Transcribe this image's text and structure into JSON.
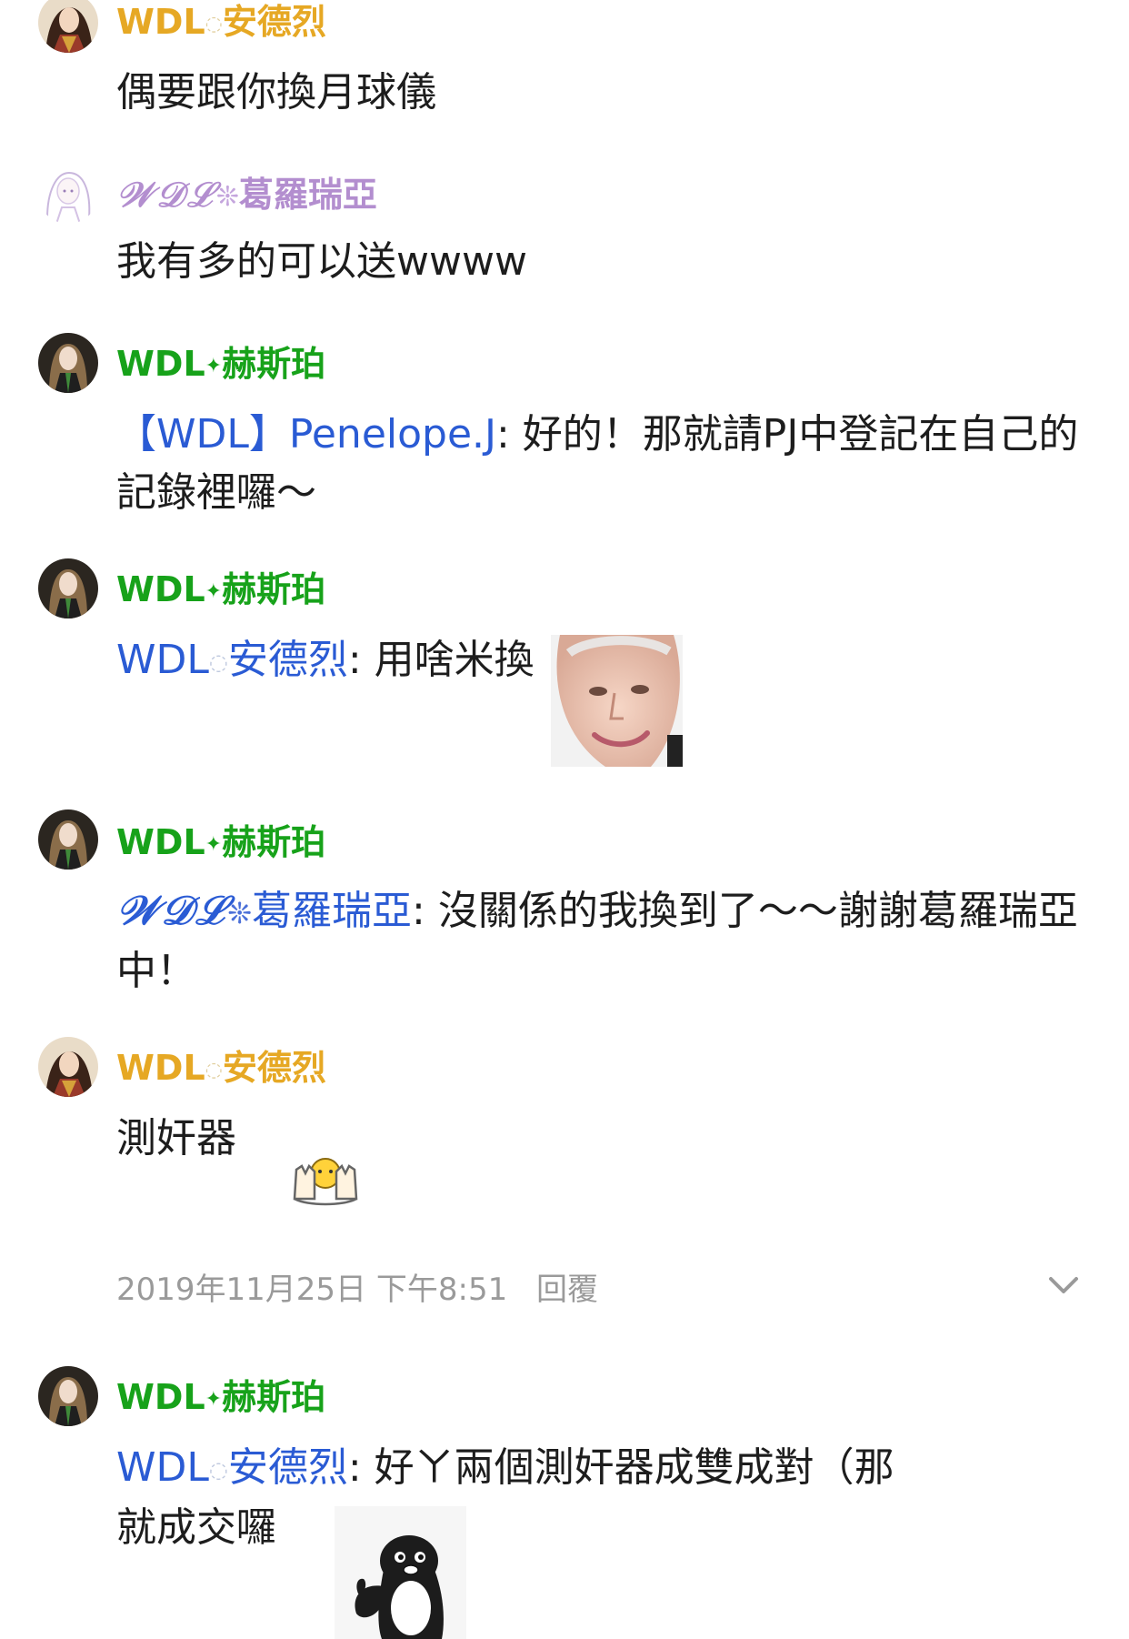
{
  "messages": [
    {
      "avatar": "portrait-avatar-andrei",
      "user": {
        "prefix": "WDL",
        "sep": "◌",
        "name": "安德烈",
        "color": "#e6a824"
      },
      "text": "偶要跟你換月球儀"
    },
    {
      "avatar": "portrait-avatar-gloria",
      "user": {
        "prefix": "𝒲𝒟ℒ",
        "sep": "❊",
        "name": "葛羅瑞亞",
        "color": "#b38ecf"
      },
      "text": "我有多的可以送wwww"
    },
    {
      "avatar": "portrait-avatar-hesper",
      "user": {
        "prefix": "WDL",
        "sep": "✦",
        "name": "赫斯珀",
        "color": "#17a21a"
      },
      "mention": "【WDL】Penelope.J",
      "text": ": 好的！那就請PJ中登記在自己的記錄裡囉～"
    },
    {
      "avatar": "portrait-avatar-hesper",
      "user": {
        "prefix": "WDL",
        "sep": "✦",
        "name": "赫斯珀",
        "color": "#17a21a"
      },
      "mention": {
        "prefix": "WDL",
        "sep": "◌",
        "name": "安德烈"
      },
      "text": ": 用啥米換",
      "sticker": "old-lady-face-sticker"
    },
    {
      "avatar": "portrait-avatar-hesper",
      "user": {
        "prefix": "WDL",
        "sep": "✦",
        "name": "赫斯珀",
        "color": "#17a21a"
      },
      "mention": {
        "prefix": "𝒲𝒟ℒ",
        "sep": "❊",
        "name": "葛羅瑞亞"
      },
      "text": ": 沒關係的我換到了～～謝謝葛羅瑞亞中！"
    },
    {
      "avatar": "portrait-avatar-andrei",
      "user": {
        "prefix": "WDL",
        "sep": "◌",
        "name": "安德烈",
        "color": "#e6a824"
      },
      "text": "測奸器",
      "sticker": "hands-up-emoji-sticker"
    },
    {
      "avatar": "portrait-avatar-hesper",
      "user": {
        "prefix": "WDL",
        "sep": "✦",
        "name": "赫斯珀",
        "color": "#17a21a"
      },
      "mention": {
        "prefix": "WDL",
        "sep": "◌",
        "name": "安德烈"
      },
      "text": ": 好ㄚ兩個測奸器成雙成對（那就成交囉",
      "sticker": "penguin-thumbs-up-sticker"
    }
  ],
  "footer": {
    "timestamp": "2019年11月25日 下午8:51",
    "reply_label": "回覆",
    "expand_icon": "chevron-down-icon"
  },
  "colors": {
    "mention": "#2a5bd4",
    "meta": "#9a9a9a"
  }
}
